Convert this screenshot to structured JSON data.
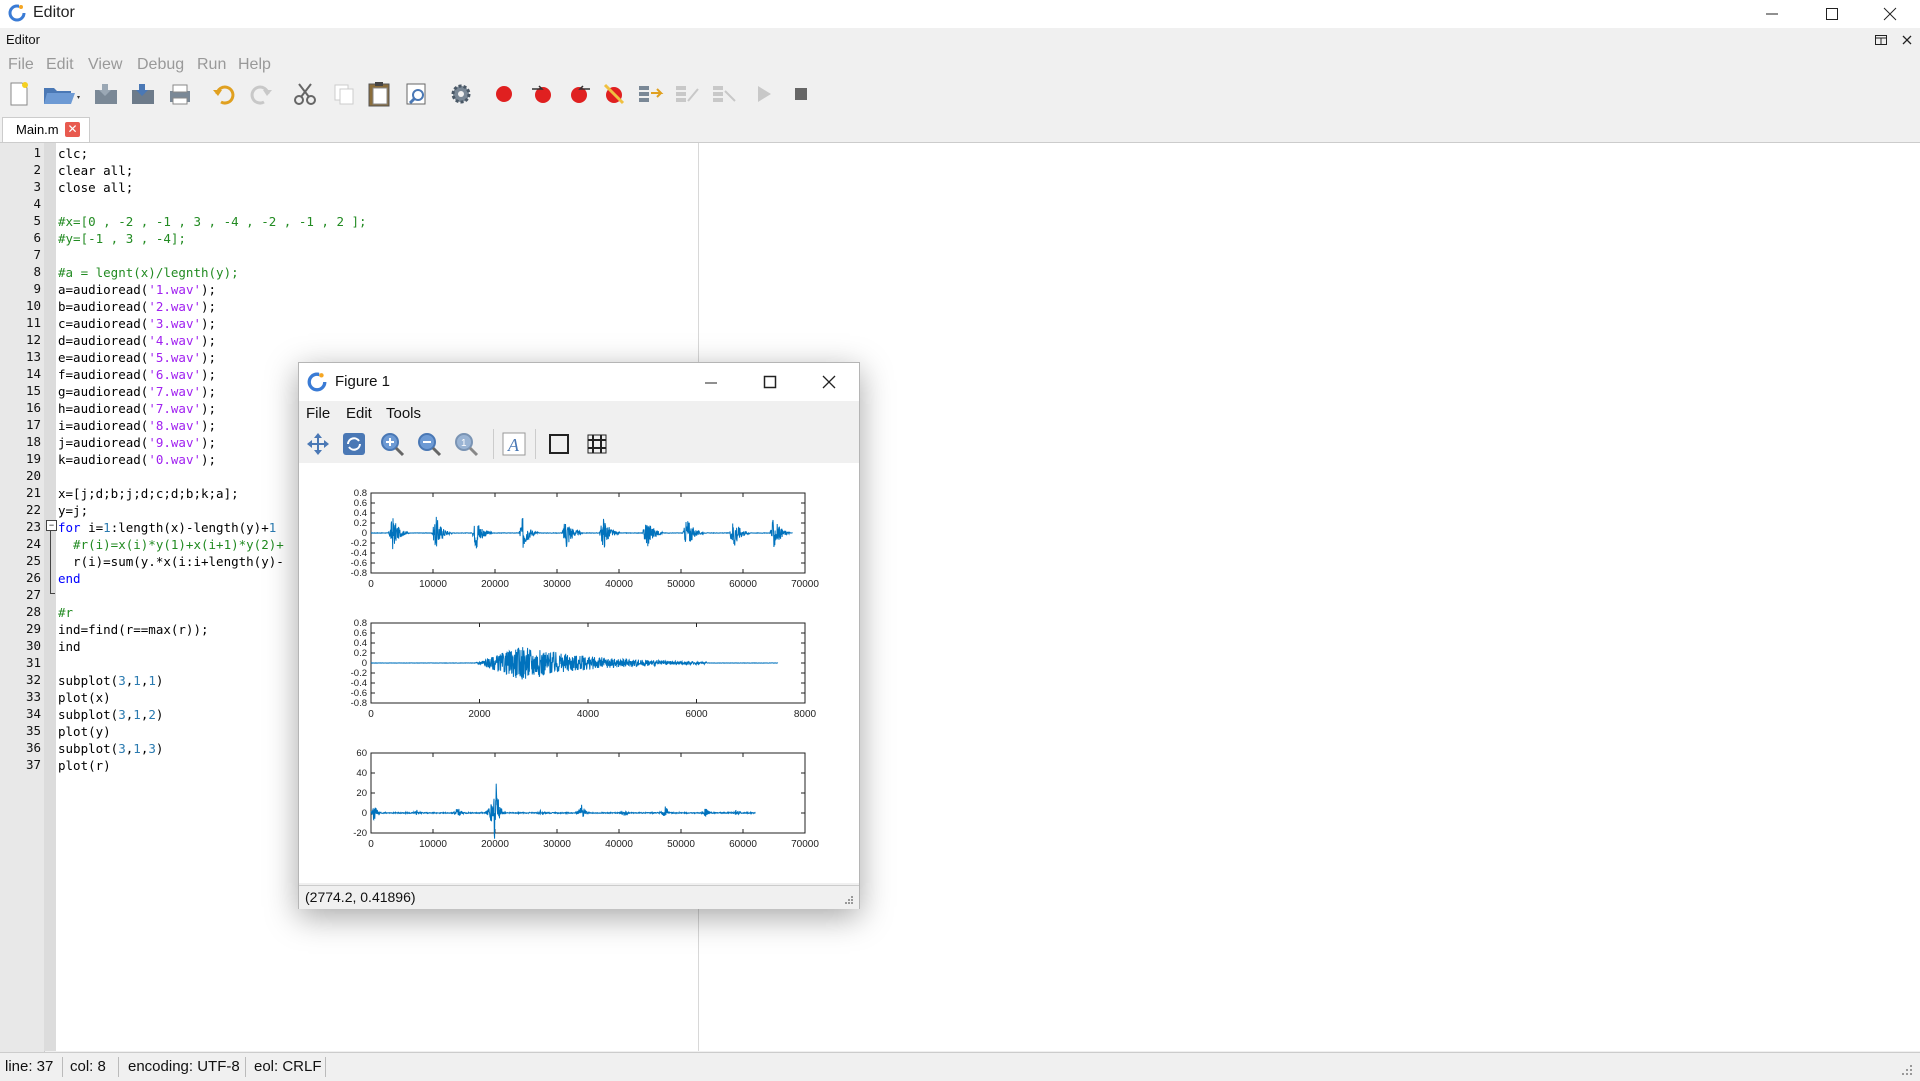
{
  "window": {
    "title": "Editor"
  },
  "panel": {
    "label": "Editor"
  },
  "menu": [
    "File",
    "Edit",
    "View",
    "Debug",
    "Run",
    "Help"
  ],
  "tab": {
    "label": "Main.m"
  },
  "code_lines": [
    [
      [
        "clc;",
        ""
      ]
    ],
    [
      [
        "clear all;",
        ""
      ]
    ],
    [
      [
        "close all;",
        ""
      ]
    ],
    [
      [
        "",
        ""
      ]
    ],
    [
      [
        "#x=[0 , -2 , -1 , 3 , -4 , -2 , -1 , 2 ];",
        "com"
      ]
    ],
    [
      [
        "#y=[-1 , 3 , -4];",
        "com"
      ]
    ],
    [
      [
        "",
        ""
      ]
    ],
    [
      [
        "#a = legnt(x)/legnth(y);",
        "com"
      ]
    ],
    [
      [
        "a=audioread(",
        ""
      ],
      [
        "'1.wav'",
        "str"
      ],
      [
        ");",
        ""
      ]
    ],
    [
      [
        "b=audioread(",
        ""
      ],
      [
        "'2.wav'",
        "str"
      ],
      [
        ");",
        ""
      ]
    ],
    [
      [
        "c=audioread(",
        ""
      ],
      [
        "'3.wav'",
        "str"
      ],
      [
        ");",
        ""
      ]
    ],
    [
      [
        "d=audioread(",
        ""
      ],
      [
        "'4.wav'",
        "str"
      ],
      [
        ");",
        ""
      ]
    ],
    [
      [
        "e=audioread(",
        ""
      ],
      [
        "'5.wav'",
        "str"
      ],
      [
        ");",
        ""
      ]
    ],
    [
      [
        "f=audioread(",
        ""
      ],
      [
        "'6.wav'",
        "str"
      ],
      [
        ");",
        ""
      ]
    ],
    [
      [
        "g=audioread(",
        ""
      ],
      [
        "'7.wav'",
        "str"
      ],
      [
        ");",
        ""
      ]
    ],
    [
      [
        "h=audioread(",
        ""
      ],
      [
        "'7.wav'",
        "str"
      ],
      [
        ");",
        ""
      ]
    ],
    [
      [
        "i=audioread(",
        ""
      ],
      [
        "'8.wav'",
        "str"
      ],
      [
        ");",
        ""
      ]
    ],
    [
      [
        "j=audioread(",
        ""
      ],
      [
        "'9.wav'",
        "str"
      ],
      [
        ");",
        ""
      ]
    ],
    [
      [
        "k=audioread(",
        ""
      ],
      [
        "'0.wav'",
        "str"
      ],
      [
        ");",
        ""
      ]
    ],
    [
      [
        "",
        ""
      ]
    ],
    [
      [
        "x=[j;d;b;j;d;c;d;b;k;a];",
        ""
      ]
    ],
    [
      [
        "y=j;",
        ""
      ]
    ],
    [
      [
        "for",
        "kw"
      ],
      [
        " i=",
        ""
      ],
      [
        "1",
        "num"
      ],
      [
        ":length(x)-length(y)+",
        ""
      ],
      [
        "1",
        "num"
      ]
    ],
    [
      [
        "  #r(i)=x(i)*y(1)+x(i+1)*y(2)+",
        "com"
      ]
    ],
    [
      [
        "  r(i)=sum(y.*x(i:i+length(y)-",
        ""
      ]
    ],
    [
      [
        "end",
        "kw"
      ]
    ],
    [
      [
        "",
        ""
      ]
    ],
    [
      [
        "#r",
        "com"
      ]
    ],
    [
      [
        "ind=find(r==max(r));",
        ""
      ]
    ],
    [
      [
        "ind",
        ""
      ]
    ],
    [
      [
        "",
        ""
      ]
    ],
    [
      [
        "subplot(",
        ""
      ],
      [
        "3",
        "num"
      ],
      [
        ",",
        ""
      ],
      [
        "1",
        "num"
      ],
      [
        ",",
        ""
      ],
      [
        "1",
        "num"
      ],
      [
        ")",
        ""
      ]
    ],
    [
      [
        "plot(x)",
        ""
      ]
    ],
    [
      [
        "subplot(",
        ""
      ],
      [
        "3",
        "num"
      ],
      [
        ",",
        ""
      ],
      [
        "1",
        "num"
      ],
      [
        ",",
        ""
      ],
      [
        "2",
        "num"
      ],
      [
        ")",
        ""
      ]
    ],
    [
      [
        "plot(y)",
        ""
      ]
    ],
    [
      [
        "subplot(",
        ""
      ],
      [
        "3",
        "num"
      ],
      [
        ",",
        ""
      ],
      [
        "1",
        "num"
      ],
      [
        ",",
        ""
      ],
      [
        "3",
        "num"
      ],
      [
        ")",
        ""
      ]
    ],
    [
      [
        "plot(r)",
        ""
      ]
    ]
  ],
  "status": {
    "line": "line: 37",
    "col": "col: 8",
    "encoding": "encoding: UTF-8",
    "eol": "eol: CRLF"
  },
  "figure": {
    "title": "Figure 1",
    "menu": [
      "File",
      "Edit",
      "Tools"
    ],
    "status": "(2774.2, 0.41896)"
  },
  "colors": {
    "accent": "#0072bd",
    "red": "#e02020"
  },
  "chart_data": [
    {
      "type": "line",
      "xlim": [
        0,
        70000
      ],
      "ylim": [
        -0.8,
        0.8
      ],
      "xticks": [
        "0",
        "10000",
        "20000",
        "30000",
        "40000",
        "50000",
        "60000",
        "70000"
      ],
      "yticks": [
        "0.8",
        "0.6",
        "0.4",
        "0.2",
        "0",
        "-0.2",
        "-0.4",
        "-0.6",
        "-0.8"
      ],
      "burst_centers": [
        3500,
        10500,
        17000,
        24500,
        31500,
        37500,
        44500,
        51000,
        58500,
        65000
      ],
      "burst_amplitude": 0.35,
      "x_end": 68000
    },
    {
      "type": "line",
      "xlim": [
        0,
        8000
      ],
      "ylim": [
        -0.8,
        0.8
      ],
      "xticks": [
        "0",
        "2000",
        "4000",
        "6000",
        "8000"
      ],
      "yticks": [
        "0.8",
        "0.6",
        "0.4",
        "0.2",
        "0",
        "-0.2",
        "-0.4",
        "-0.6",
        "-0.8"
      ],
      "signal_start": 1900,
      "signal_end": 6200,
      "peak_x": 2800,
      "peak_amplitude": 0.35,
      "x_end": 7500
    },
    {
      "type": "line",
      "xlim": [
        0,
        70000
      ],
      "ylim": [
        -20,
        60
      ],
      "xticks": [
        "0",
        "10000",
        "20000",
        "30000",
        "40000",
        "50000",
        "60000",
        "70000"
      ],
      "yticks": [
        "60",
        "40",
        "20",
        "0",
        "-20"
      ],
      "peaks": [
        [
          500,
          12
        ],
        [
          7500,
          4
        ],
        [
          14000,
          8
        ],
        [
          20000,
          48
        ],
        [
          27500,
          4
        ],
        [
          34000,
          10
        ],
        [
          41000,
          4
        ],
        [
          47500,
          8
        ],
        [
          54000,
          6
        ],
        [
          59000,
          4
        ]
      ],
      "x_end": 62000
    }
  ]
}
